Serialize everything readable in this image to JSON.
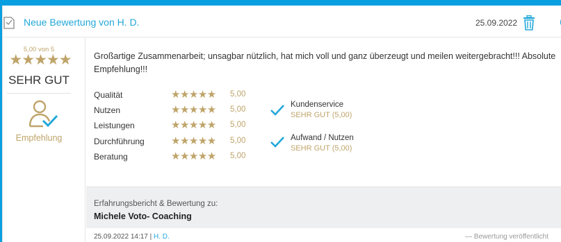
{
  "header": {
    "title": "Neue Bewertung von H. D.",
    "date": "25.09.2022"
  },
  "summary": {
    "score_text": "5,00 von 5",
    "stars": "★★★★★",
    "verdict": "SEHR GUT",
    "recommendation": "Empfehlung"
  },
  "review": {
    "text": "Großartige Zusammenarbeit; unsagbar nützlich, hat mich voll und ganz überzeugt und meilen weitergebracht!!! Absolute Empfehlung!!!"
  },
  "criteria": [
    {
      "label": "Qualität",
      "stars": "★★★★★",
      "value": "5,00"
    },
    {
      "label": "Nutzen",
      "stars": "★★★★★",
      "value": "5,00"
    },
    {
      "label": "Leistungen",
      "stars": "★★★★★",
      "value": "5,00"
    },
    {
      "label": "Durchführung",
      "stars": "★★★★★",
      "value": "5,00"
    },
    {
      "label": "Beratung",
      "stars": "★★★★★",
      "value": "5,00"
    }
  ],
  "extra_ratings": [
    {
      "title": "Kundenservice",
      "value": "SEHR GUT (5,00)"
    },
    {
      "title": "Aufwand / Nutzen",
      "value": "SEHR GUT (5,00)"
    }
  ],
  "experience": {
    "label": "Erfahrungsbericht & Bewertung zu:",
    "name": "Michele Voto- Coaching"
  },
  "footer": {
    "datetime": "25.09.2022 14:17",
    "separator": " | ",
    "user": "H. D.",
    "right_text": "— Bewertung veröffentlicht"
  },
  "colors": {
    "accent": "#22a7d9",
    "gold": "#bfa46a",
    "frame": "#0a9fe0"
  },
  "icons": [
    "document-icon",
    "trash-icon",
    "recommendation-icon",
    "check-icon"
  ]
}
